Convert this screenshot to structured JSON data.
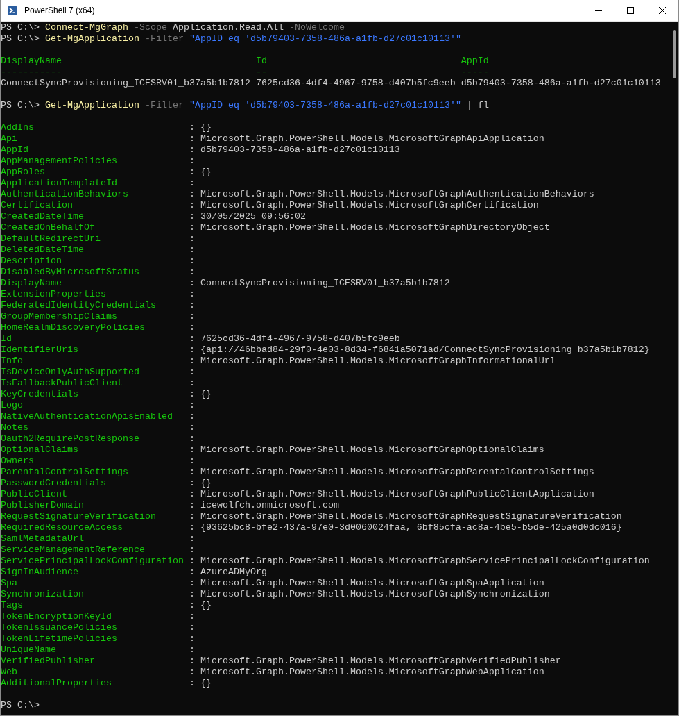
{
  "window": {
    "title": "PowerShell 7 (x64)"
  },
  "console": [
    {
      "kind": "command",
      "parts": [
        {
          "kind": "prompt",
          "text": "PS C:\\>"
        },
        {
          "kind": "cmdlet",
          "text": "Connect-MgGraph"
        },
        {
          "kind": "parameter",
          "text": "-Scope"
        },
        {
          "kind": "argument",
          "text": "Application.Read.All"
        },
        {
          "kind": "parameter",
          "text": "-NoWelcome"
        }
      ]
    },
    {
      "kind": "command",
      "parts": [
        {
          "kind": "prompt",
          "text": "PS C:\\>"
        },
        {
          "kind": "cmdlet",
          "text": "Get-MgApplication"
        },
        {
          "kind": "parameter",
          "text": "-Filter"
        },
        {
          "kind": "string",
          "text": "\"AppID eq 'd5b79403-7358-486a-a1fb-d27c01c10113'\""
        }
      ]
    },
    {
      "kind": "table",
      "columns": [
        "DisplayName",
        "Id",
        "AppId"
      ],
      "underlines": [
        "-----------",
        "--",
        "-----"
      ],
      "rows": [
        [
          "ConnectSyncProvisioning_ICESRV01_b37a5b1b7812",
          "7625cd36-4df4-4967-9758-d407b5fc9eeb",
          "d5b79403-7358-486a-a1fb-d27c01c10113"
        ]
      ]
    },
    {
      "kind": "command",
      "parts": [
        {
          "kind": "prompt",
          "text": "PS C:\\>"
        },
        {
          "kind": "cmdlet",
          "text": "Get-MgApplication"
        },
        {
          "kind": "parameter",
          "text": "-Filter"
        },
        {
          "kind": "string",
          "text": "\"AppID eq 'd5b79403-7358-486a-a1fb-d27c01c10113'\""
        },
        {
          "kind": "argument",
          "text": "| fl"
        }
      ]
    },
    {
      "kind": "list",
      "items": [
        {
          "name": "AddIns",
          "value": ": {}"
        },
        {
          "name": "Api",
          "value": ": Microsoft.Graph.PowerShell.Models.MicrosoftGraphApiApplication"
        },
        {
          "name": "AppId",
          "value": ": d5b79403-7358-486a-a1fb-d27c01c10113"
        },
        {
          "name": "AppManagementPolicies",
          "value": ":"
        },
        {
          "name": "AppRoles",
          "value": ": {}"
        },
        {
          "name": "ApplicationTemplateId",
          "value": ":"
        },
        {
          "name": "AuthenticationBehaviors",
          "value": ": Microsoft.Graph.PowerShell.Models.MicrosoftGraphAuthenticationBehaviors"
        },
        {
          "name": "Certification",
          "value": ": Microsoft.Graph.PowerShell.Models.MicrosoftGraphCertification"
        },
        {
          "name": "CreatedDateTime",
          "value": ": 30/05/2025 09:56:02"
        },
        {
          "name": "CreatedOnBehalfOf",
          "value": ": Microsoft.Graph.PowerShell.Models.MicrosoftGraphDirectoryObject"
        },
        {
          "name": "DefaultRedirectUri",
          "value": ":"
        },
        {
          "name": "DeletedDateTime",
          "value": ":"
        },
        {
          "name": "Description",
          "value": ":"
        },
        {
          "name": "DisabledByMicrosoftStatus",
          "value": ":"
        },
        {
          "name": "DisplayName",
          "value": ": ConnectSyncProvisioning_ICESRV01_b37a5b1b7812"
        },
        {
          "name": "ExtensionProperties",
          "value": ":"
        },
        {
          "name": "FederatedIdentityCredentials",
          "value": ":"
        },
        {
          "name": "GroupMembershipClaims",
          "value": ":"
        },
        {
          "name": "HomeRealmDiscoveryPolicies",
          "value": ":"
        },
        {
          "name": "Id",
          "value": ": 7625cd36-4df4-4967-9758-d407b5fc9eeb"
        },
        {
          "name": "IdentifierUris",
          "value": ": {api://46bbad84-29f0-4e03-8d34-f6841a5071ad/ConnectSyncProvisioning_b37a5b1b7812}"
        },
        {
          "name": "Info",
          "value": ": Microsoft.Graph.PowerShell.Models.MicrosoftGraphInformationalUrl"
        },
        {
          "name": "IsDeviceOnlyAuthSupported",
          "value": ":"
        },
        {
          "name": "IsFallbackPublicClient",
          "value": ":"
        },
        {
          "name": "KeyCredentials",
          "value": ": {}"
        },
        {
          "name": "Logo",
          "value": ":"
        },
        {
          "name": "NativeAuthenticationApisEnabled",
          "value": ":"
        },
        {
          "name": "Notes",
          "value": ":"
        },
        {
          "name": "Oauth2RequirePostResponse",
          "value": ":"
        },
        {
          "name": "OptionalClaims",
          "value": ": Microsoft.Graph.PowerShell.Models.MicrosoftGraphOptionalClaims"
        },
        {
          "name": "Owners",
          "value": ":"
        },
        {
          "name": "ParentalControlSettings",
          "value": ": Microsoft.Graph.PowerShell.Models.MicrosoftGraphParentalControlSettings"
        },
        {
          "name": "PasswordCredentials",
          "value": ": {}"
        },
        {
          "name": "PublicClient",
          "value": ": Microsoft.Graph.PowerShell.Models.MicrosoftGraphPublicClientApplication"
        },
        {
          "name": "PublisherDomain",
          "value": ": icewolfch.onmicrosoft.com"
        },
        {
          "name": "RequestSignatureVerification",
          "value": ": Microsoft.Graph.PowerShell.Models.MicrosoftGraphRequestSignatureVerification"
        },
        {
          "name": "RequiredResourceAccess",
          "value": ": {93625bc8-bfe2-437a-97e0-3d0060024faa, 6bf85cfa-ac8a-4be5-b5de-425a0d0dc016}"
        },
        {
          "name": "SamlMetadataUrl",
          "value": ":"
        },
        {
          "name": "ServiceManagementReference",
          "value": ":"
        },
        {
          "name": "ServicePrincipalLockConfiguration",
          "value": ": Microsoft.Graph.PowerShell.Models.MicrosoftGraphServicePrincipalLockConfiguration"
        },
        {
          "name": "SignInAudience",
          "value": ": AzureADMyOrg"
        },
        {
          "name": "Spa",
          "value": ": Microsoft.Graph.PowerShell.Models.MicrosoftGraphSpaApplication"
        },
        {
          "name": "Synchronization",
          "value": ": Microsoft.Graph.PowerShell.Models.MicrosoftGraphSynchronization"
        },
        {
          "name": "Tags",
          "value": ": {}"
        },
        {
          "name": "TokenEncryptionKeyId",
          "value": ":"
        },
        {
          "name": "TokenIssuancePolicies",
          "value": ":"
        },
        {
          "name": "TokenLifetimePolicies",
          "value": ":"
        },
        {
          "name": "UniqueName",
          "value": ":"
        },
        {
          "name": "VerifiedPublisher",
          "value": ": Microsoft.Graph.PowerShell.Models.MicrosoftGraphVerifiedPublisher"
        },
        {
          "name": "Web",
          "value": ": Microsoft.Graph.PowerShell.Models.MicrosoftGraphWebApplication"
        },
        {
          "name": "AdditionalProperties",
          "value": ": {}"
        }
      ]
    },
    {
      "kind": "command",
      "parts": [
        {
          "kind": "prompt",
          "text": "PS C:\\>"
        }
      ]
    }
  ]
}
